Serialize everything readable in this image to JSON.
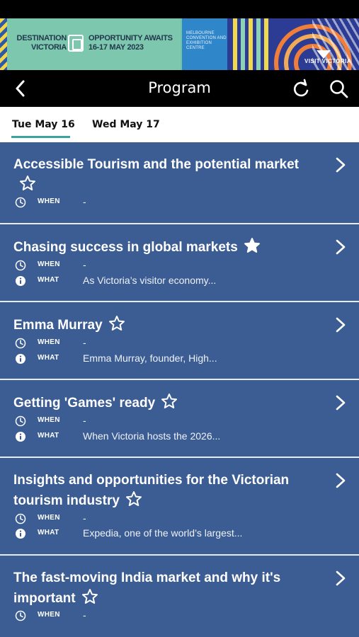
{
  "banner": {
    "event_name": "DESTINATION VICTORIA",
    "tagline": "OPPORTUNITY AWAITS",
    "dates": "16-17 MAY 2023",
    "venue": "MELBOURNE CONVENTION AND EXHIBITION CENTRE",
    "sponsor": "VISIT VICTORIA"
  },
  "nav": {
    "title": "Program",
    "back_icon": "chevron-left-icon",
    "refresh_icon": "refresh-icon",
    "search_icon": "search-icon"
  },
  "tabs": [
    {
      "label": "Tue May 16",
      "selected": true
    },
    {
      "label": "Wed May 17",
      "selected": false
    }
  ],
  "colors": {
    "header_bg": "#000000",
    "list_bg": "#3c5d93",
    "tab_accent": "#3aa49a",
    "text_on_list": "#ffffff"
  },
  "meta_labels": {
    "when": "WHEN",
    "what": "WHAT"
  },
  "sessions": [
    {
      "title": "Accessible Tourism and the potential market",
      "favorited": false,
      "when": "-",
      "what": null
    },
    {
      "title": "Chasing success in global markets",
      "favorited": true,
      "when": "-",
      "what": "As Victoria’s visitor economy..."
    },
    {
      "title": "Emma Murray",
      "favorited": false,
      "when": "-",
      "what": "Emma Murray, founder, High..."
    },
    {
      "title": "Getting 'Games' ready",
      "favorited": false,
      "when": "-",
      "what": "When Victoria hosts the 2026..."
    },
    {
      "title": "Insights and opportunities for the Victorian tourism industry",
      "favorited": false,
      "when": "-",
      "what": "Expedia, one of the world’s largest..."
    },
    {
      "title": "The fast-moving India market and why it's important",
      "favorited": false,
      "when": "-",
      "what": null
    }
  ]
}
